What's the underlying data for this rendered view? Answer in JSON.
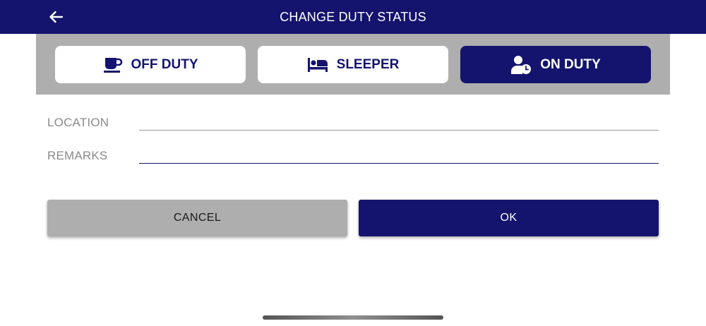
{
  "header": {
    "title": "CHANGE DUTY STATUS",
    "back_icon": "arrow-left-icon",
    "background_color": "#14146e"
  },
  "status_options": [
    {
      "label": "OFF DUTY",
      "icon": "coffee-cup-icon",
      "selected": false
    },
    {
      "label": "SLEEPER",
      "icon": "bed-icon",
      "selected": false
    },
    {
      "label": "ON DUTY",
      "icon": "user-clock-icon",
      "selected": true
    }
  ],
  "form": {
    "location": {
      "label": "LOCATION",
      "value": ""
    },
    "remarks": {
      "label": "REMARKS",
      "value": ""
    }
  },
  "actions": {
    "cancel_label": "CANCEL",
    "ok_label": "OK"
  },
  "colors": {
    "primary": "#14146e",
    "panel_gray": "#aeaeae",
    "label_gray": "#8a8a8a"
  }
}
